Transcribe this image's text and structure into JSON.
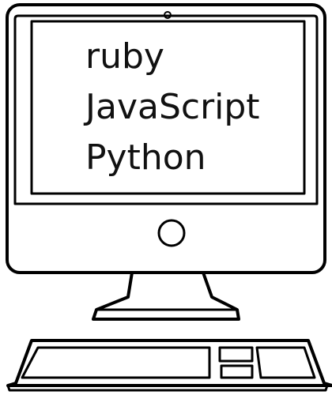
{
  "screen": {
    "lines": [
      "ruby",
      "JavaScript",
      "Python"
    ]
  },
  "colors": {
    "stroke": "#000000",
    "background": "#ffffff"
  },
  "icons": {
    "camera": "webcam-dot-icon",
    "power": "power-button-icon"
  }
}
